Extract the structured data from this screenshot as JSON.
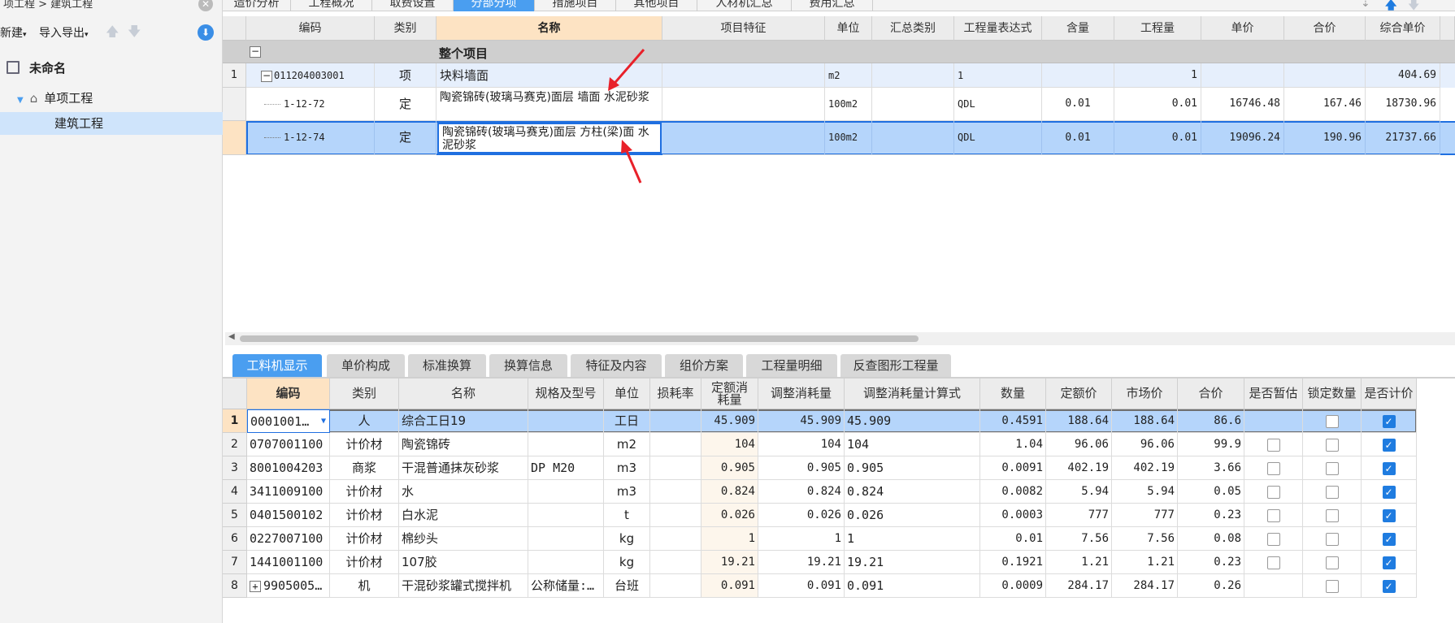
{
  "breadcrumb": "项工程 > 建筑工程",
  "left": {
    "new_label": "新建",
    "import_label": "导入导出",
    "tree": [
      {
        "label": "未命名",
        "level": 0
      },
      {
        "label": "单项工程",
        "level": 1
      },
      {
        "label": "建筑工程",
        "level": 2,
        "selected": true
      }
    ]
  },
  "tabs": [
    "造价分析",
    "工程概况",
    "取费设置",
    "分部分项",
    "措施项目",
    "其他项目",
    "人材机汇总",
    "费用汇总"
  ],
  "active_tab": "分部分项",
  "upper_table": {
    "headers": [
      "编码",
      "类别",
      "名称",
      "项目特征",
      "单位",
      "汇总类别",
      "工程量表达式",
      "含量",
      "工程量",
      "单价",
      "合价",
      "综合单价"
    ],
    "whole_project_label": "整个项目",
    "rows": [
      {
        "no": "1",
        "code": "011204003001",
        "type": "项",
        "name": "块料墙面",
        "feature": "",
        "unit": "m2",
        "summary": "",
        "expr": "1",
        "content": "",
        "qty": "1",
        "price": "",
        "total": "",
        "comp": "404.69"
      },
      {
        "no": "",
        "code": "1-12-72",
        "type": "定",
        "name": "陶瓷锦砖(玻璃马赛克)面层 墙面 水泥砂浆",
        "feature": "",
        "unit": "100m2",
        "summary": "",
        "expr": "QDL",
        "content": "0.01",
        "qty": "0.01",
        "price": "16746.48",
        "total": "167.46",
        "comp": "18730.96"
      },
      {
        "no": "",
        "code": "1-12-74",
        "type": "定",
        "name": "陶瓷锦砖(玻璃马赛克)面层 方柱(梁)面 水泥砂浆",
        "feature": "",
        "unit": "100m2",
        "summary": "",
        "expr": "QDL",
        "content": "0.01",
        "qty": "0.01",
        "price": "19096.24",
        "total": "190.96",
        "comp": "21737.66"
      }
    ]
  },
  "bottom_tabs": [
    "工料机显示",
    "单价构成",
    "标准换算",
    "换算信息",
    "特征及内容",
    "组价方案",
    "工程量明细",
    "反查图形工程量"
  ],
  "active_bottom_tab": "工料机显示",
  "lower_table": {
    "headers": [
      "编码",
      "类别",
      "名称",
      "规格及型号",
      "单位",
      "损耗率",
      "定额消耗量",
      "调整消耗量",
      "调整消耗量计算式",
      "数量",
      "定额价",
      "市场价",
      "合价",
      "是否暂估",
      "锁定数量",
      "是否计价"
    ],
    "rows": [
      {
        "no": "1",
        "code": "0001001…",
        "type": "人",
        "name": "综合工日19",
        "spec": "",
        "unit": "工日",
        "loss": "",
        "quota": "45.909",
        "adj": "45.909",
        "formula": "45.909",
        "qty": "0.4591",
        "qprice": "188.64",
        "mprice": "188.64",
        "total": "86.6",
        "est": null,
        "lock": false,
        "priced": true
      },
      {
        "no": "2",
        "code": "0707001100",
        "type": "计价材",
        "name": "陶瓷锦砖",
        "spec": "",
        "unit": "m2",
        "loss": "",
        "quota": "104",
        "adj": "104",
        "formula": "104",
        "qty": "1.04",
        "qprice": "96.06",
        "mprice": "96.06",
        "total": "99.9",
        "est": false,
        "lock": false,
        "priced": true
      },
      {
        "no": "3",
        "code": "8001004203",
        "type": "商浆",
        "name": "干混普通抹灰砂浆",
        "spec": "DP M20",
        "unit": "m3",
        "loss": "",
        "quota": "0.905",
        "adj": "0.905",
        "formula": "0.905",
        "qty": "0.0091",
        "qprice": "402.19",
        "mprice": "402.19",
        "total": "3.66",
        "est": false,
        "lock": false,
        "priced": true
      },
      {
        "no": "4",
        "code": "3411009100",
        "type": "计价材",
        "name": "水",
        "spec": "",
        "unit": "m3",
        "loss": "",
        "quota": "0.824",
        "adj": "0.824",
        "formula": "0.824",
        "qty": "0.0082",
        "qprice": "5.94",
        "mprice": "5.94",
        "total": "0.05",
        "est": false,
        "lock": false,
        "priced": true
      },
      {
        "no": "5",
        "code": "0401500102",
        "type": "计价材",
        "name": "白水泥",
        "spec": "",
        "unit": "t",
        "loss": "",
        "quota": "0.026",
        "adj": "0.026",
        "formula": "0.026",
        "qty": "0.0003",
        "qprice": "777",
        "mprice": "777",
        "total": "0.23",
        "est": false,
        "lock": false,
        "priced": true
      },
      {
        "no": "6",
        "code": "0227007100",
        "type": "计价材",
        "name": "棉纱头",
        "spec": "",
        "unit": "kg",
        "loss": "",
        "quota": "1",
        "adj": "1",
        "formula": "1",
        "qty": "0.01",
        "qprice": "7.56",
        "mprice": "7.56",
        "total": "0.08",
        "est": false,
        "lock": false,
        "priced": true
      },
      {
        "no": "7",
        "code": "1441001100",
        "type": "计价材",
        "name": "107胶",
        "spec": "",
        "unit": "kg",
        "loss": "",
        "quota": "19.21",
        "adj": "19.21",
        "formula": "19.21",
        "qty": "0.1921",
        "qprice": "1.21",
        "mprice": "1.21",
        "total": "0.23",
        "est": false,
        "lock": false,
        "priced": true
      },
      {
        "no": "8",
        "code": "9905005…",
        "type": "机",
        "name": "干混砂浆罐式搅拌机",
        "spec": "公称储量:…",
        "unit": "台班",
        "loss": "",
        "quota": "0.091",
        "adj": "0.091",
        "formula": "0.091",
        "qty": "0.0009",
        "qprice": "284.17",
        "mprice": "284.17",
        "total": "0.26",
        "est": null,
        "lock": false,
        "priced": true
      }
    ]
  },
  "colors": {
    "accent": "#4a9ef0",
    "selection": "#b5d5fb",
    "header_highlight": "#fde3c3",
    "arrow": "#e8212a"
  }
}
